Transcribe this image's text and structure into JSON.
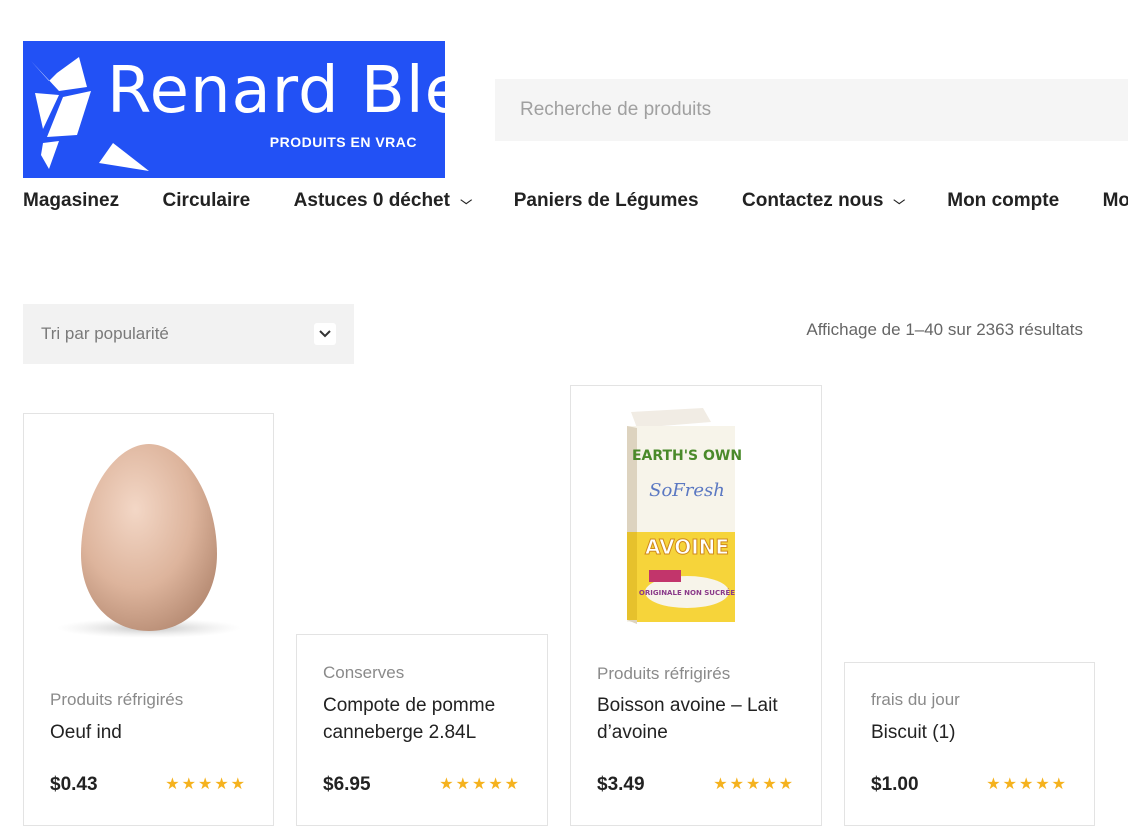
{
  "brand": {
    "title": "Renard Bleu",
    "subtitle": "PRODUITS EN VRAC",
    "color": "#2251f5"
  },
  "search": {
    "placeholder": "Recherche de produits",
    "value": ""
  },
  "nav": {
    "items": [
      {
        "label": "Magasinez"
      },
      {
        "label": "Circulaire"
      },
      {
        "label": "Astuces 0 déchet",
        "dropdown": "chevron-down-icon"
      },
      {
        "label": "Paniers de Légumes"
      },
      {
        "label": "Contactez nous",
        "dropdown": "chevron-down-icon"
      },
      {
        "label": "Mon compte"
      },
      {
        "label": "Mon p"
      }
    ]
  },
  "sort": {
    "selected": "Tri par popularité"
  },
  "results_text": "Affichage de 1–40 sur 2363 résultats",
  "products": [
    {
      "category": "Produits réfrigirés",
      "name": "Oeuf ind",
      "price": "$0.43",
      "stars": "★★★★★",
      "image": "egg"
    },
    {
      "category": "Conserves",
      "name": "Compote de pomme canneberge 2.84L",
      "price": "$6.95",
      "stars": "★★★★★",
      "image": ""
    },
    {
      "category": "Produits réfrigirés",
      "name": "Boisson avoine – Lait d’avoine",
      "price": "$3.49",
      "stars": "★★★★★",
      "image": "oat-milk-carton",
      "image_text": {
        "brand": "EARTH'S OWN",
        "line": "SoFresh",
        "product": "AVOINE",
        "flavor": "ORIGINALE NON SUCRÉE"
      }
    },
    {
      "category": "frais du jour",
      "name": "Biscuit (1)",
      "price": "$1.00",
      "stars": "★★★★★",
      "image": ""
    }
  ],
  "colors": {
    "star": "#f5b21e",
    "text": "#222222",
    "muted": "#8a8a8a"
  }
}
